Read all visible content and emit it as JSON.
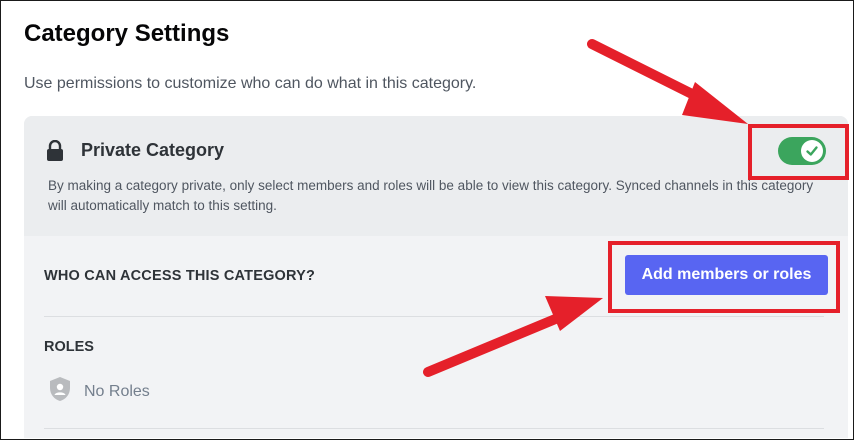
{
  "page": {
    "title": "Category Settings",
    "description": "Use permissions to customize who can do what in this category."
  },
  "private_category": {
    "icon": "lock-icon",
    "title": "Private Category",
    "description": "By making a category private, only select members and roles will be able to view this category. Synced channels in this category will automatically match to this setting.",
    "toggle_on": true,
    "toggle_icon": "check-icon"
  },
  "access": {
    "label": "WHO CAN ACCESS THIS CATEGORY?",
    "add_button_label": "Add members or roles"
  },
  "roles": {
    "label": "ROLES",
    "empty_icon": "shield-user-icon",
    "empty_text": "No Roles"
  },
  "colors": {
    "accent": "#5865f2",
    "toggle_on": "#3ba55d",
    "annotation": "#e5202a",
    "panel_bg": "#f2f3f5"
  }
}
